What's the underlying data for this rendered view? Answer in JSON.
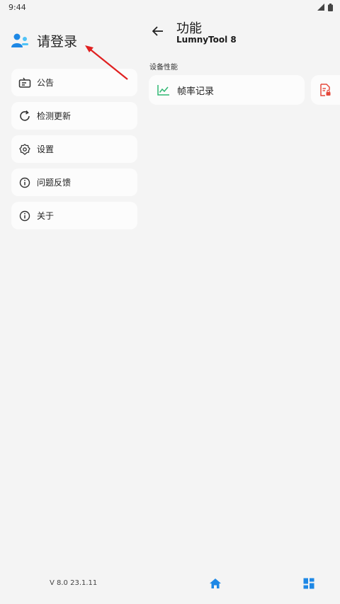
{
  "status_bar": {
    "time": "9:44"
  },
  "drawer": {
    "login_label": "请登录",
    "menu": [
      {
        "label": "公告",
        "icon": "announcement-icon"
      },
      {
        "label": "检测更新",
        "icon": "refresh-icon"
      },
      {
        "label": "设置",
        "icon": "gear-icon"
      },
      {
        "label": "问题反馈",
        "icon": "info-icon"
      },
      {
        "label": "关于",
        "icon": "info-icon"
      }
    ],
    "version": "V 8.0 23.1.11"
  },
  "main": {
    "title": "功能",
    "subtitle": "LumnyTool 8",
    "section_label": "设备性能",
    "cards": [
      {
        "label": "帧率记录",
        "icon": "chart-line-icon"
      },
      {
        "label": "",
        "icon": "document-lock-icon"
      }
    ]
  },
  "colors": {
    "accent": "#1e88e5",
    "chart_green": "#2eb872",
    "doc_red": "#e5483b",
    "annotation_red": "#e02020"
  }
}
